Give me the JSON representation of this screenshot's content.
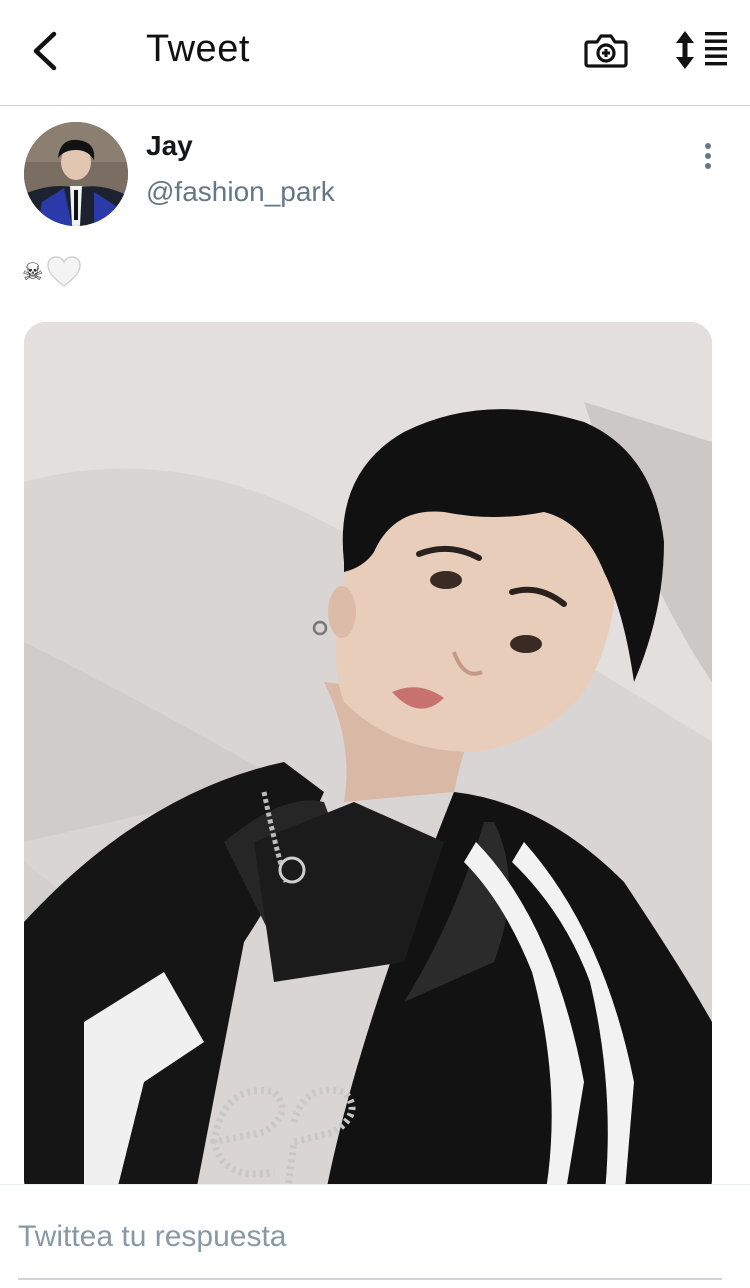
{
  "header": {
    "title": "Tweet",
    "back_icon": "chevron-left-icon",
    "camera_icon": "camera-add-icon",
    "sort_icon": "sort-list-icon"
  },
  "tweet": {
    "author": {
      "display_name": "Jay",
      "handle": "@fashion_park"
    },
    "text": {
      "emoji_1": "☠",
      "emoji_2_icon": "white-heart-icon"
    },
    "media": {
      "type": "photo"
    }
  },
  "reply": {
    "placeholder": "Twittea tu respuesta"
  },
  "colors": {
    "handle": "#657786",
    "placeholder": "#8899a6",
    "divider": "#d0d4d8"
  }
}
